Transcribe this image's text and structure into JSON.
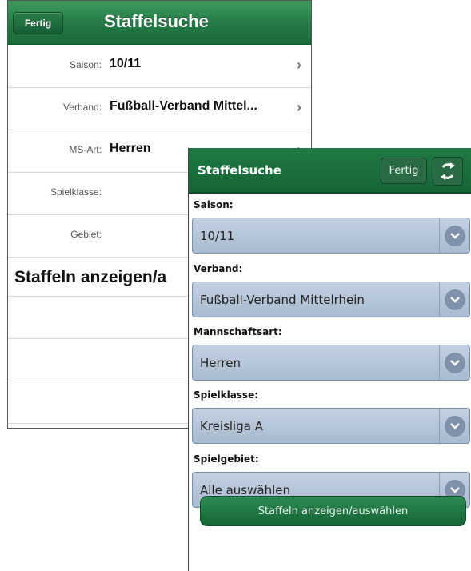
{
  "ios": {
    "done_label": "Fertig",
    "title": "Staffelsuche",
    "rows": [
      {
        "label": "Saison:",
        "value": "10/11"
      },
      {
        "label": "Verband:",
        "value": "Fußball-Verband Mittel..."
      },
      {
        "label": "MS-Art:",
        "value": "Herren"
      },
      {
        "label": "Spielklasse:",
        "value": ""
      },
      {
        "label": "Gebiet:",
        "value": ""
      }
    ],
    "show_label": "Staffeln anzeigen/a"
  },
  "android": {
    "title": "Staffelsuche",
    "done_label": "Fertig",
    "fields": [
      {
        "label": "Saison:",
        "value": "10/11"
      },
      {
        "label": "Verband:",
        "value": "Fußball-Verband Mittelrhein"
      },
      {
        "label": "Mannschaftsart:",
        "value": "Herren"
      },
      {
        "label": "Spielklasse:",
        "value": "Kreisliga A"
      },
      {
        "label": "Spielgebiet:",
        "value": "Alle auswählen"
      }
    ],
    "submit_label": "Staffeln anzeigen/auswählen"
  }
}
